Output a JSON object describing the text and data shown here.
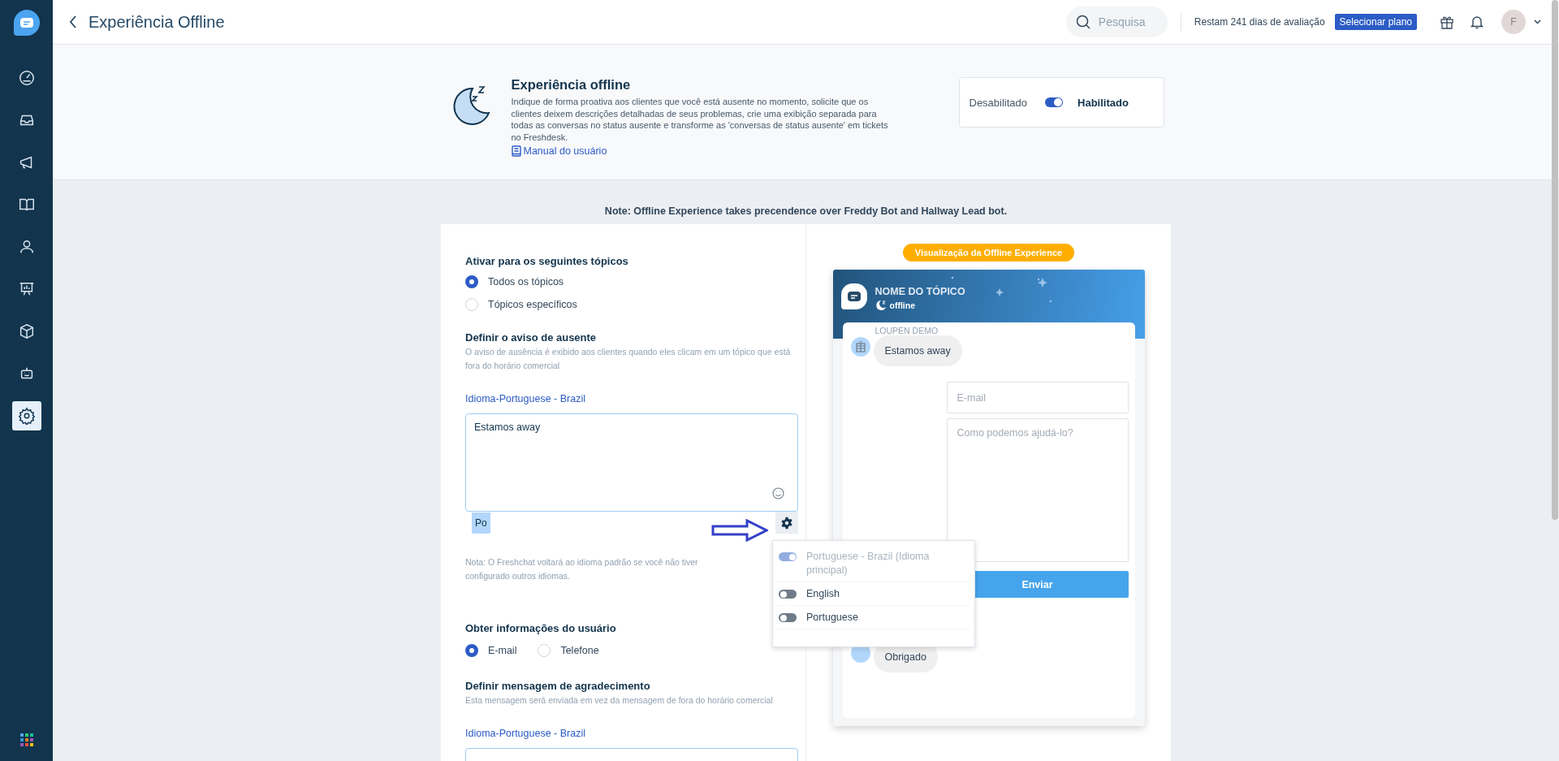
{
  "sidebar": {
    "items": [
      {
        "selected": false
      },
      {
        "selected": false
      },
      {
        "selected": false
      },
      {
        "selected": false
      },
      {
        "selected": false
      },
      {
        "selected": false
      },
      {
        "selected": false
      },
      {
        "selected": false
      },
      {
        "selected": true
      }
    ]
  },
  "topbar": {
    "title": "Experiência Offline",
    "search": {
      "placeholder": "Pesquisa"
    },
    "trial": "Restam 241 dias de avaliação",
    "plan_button": "Selecionar plano",
    "avatar": "F"
  },
  "header": {
    "title": "Experiência offline",
    "description": "Indique de forma proativa aos clientes que você está ausente no momento, solicite que os clientes deixem descrições detalhadas de seus problemas, crie uma exibição separada para todas as conversas no status ausente e transforme as 'conversas de status ausente' em tickets no Freshdesk.",
    "manual_link": "Manual do usuário",
    "toggle": {
      "off_label": "Desabilitado",
      "on_label": "Habilitado",
      "on": true
    }
  },
  "note": "Note: Offline Experience takes precendence over Freddy Bot and Hallway Lead bot.",
  "form": {
    "topics": {
      "heading": "Ativar para os seguintes tópicos",
      "options": [
        {
          "label": "Todos os tópicos",
          "selected": true
        },
        {
          "label": "Tópicos específicos",
          "selected": false
        }
      ]
    },
    "away": {
      "heading": "Definir o aviso de ausente",
      "hint": "O aviso de ausência é exibido aos clientes quando eles clicam em um tópico que está fora do horário comercial",
      "language": "Idioma-Portuguese - Brazil",
      "message": "Estamos away",
      "lang_tag": "Po",
      "footnote": "Nota: O Freshchat voltará ao idioma padrão se você não tiver configurado outros idiomas."
    },
    "user_info": {
      "heading": "Obter informações do usuário",
      "options": [
        {
          "label": "E-mail",
          "selected": true
        },
        {
          "label": "Telefone",
          "selected": false
        }
      ]
    },
    "thanks": {
      "heading": "Definir mensagem de agradecimento",
      "hint": "Esta mensagem será enviada em vez da mensagem de fora do horário comercial",
      "language": "Idioma-Portuguese - Brazil"
    }
  },
  "language_menu": {
    "items": [
      {
        "label": "Portuguese - Brazil (Idioma principal)",
        "on": true,
        "disabled": true
      },
      {
        "label": "English",
        "on": false,
        "disabled": false
      },
      {
        "label": "Portuguese",
        "on": false,
        "disabled": false
      }
    ]
  },
  "preview": {
    "badge": "Visualização da Offline Experience",
    "topic_name": "NOME DO TÓPICO",
    "status": "offline",
    "agent": "LOUPEN DEMO",
    "message": "Estamos away",
    "email_placeholder": "E-mail",
    "question_placeholder": "Como podemos ajudá-lo?",
    "send_button": "Enviar",
    "thanks_message": "Obrigado"
  }
}
